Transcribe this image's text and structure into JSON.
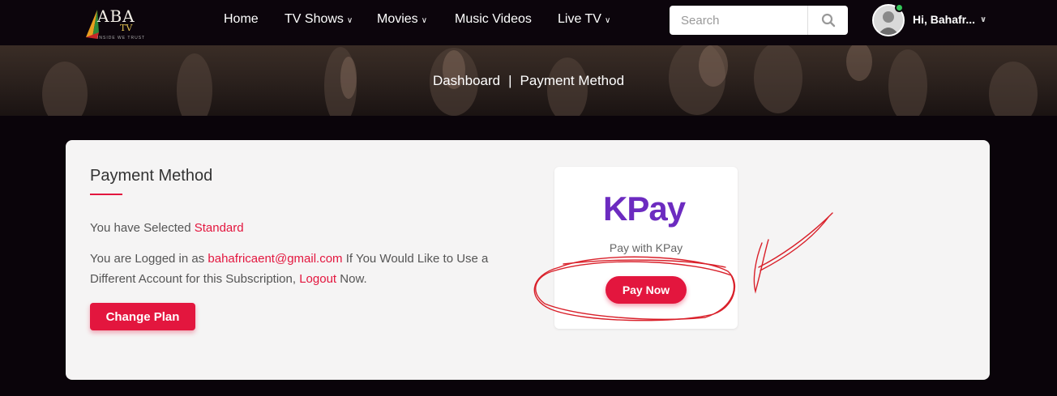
{
  "header": {
    "logo": {
      "letters": "ABA",
      "sub": "TV",
      "tagline": "INSIDE WE TRUST"
    },
    "nav": [
      {
        "label": "Home",
        "has_dropdown": false
      },
      {
        "label": "TV Shows",
        "has_dropdown": true
      },
      {
        "label": "Movies",
        "has_dropdown": true
      },
      {
        "label": "Music Videos",
        "has_dropdown": false
      },
      {
        "label": "Live TV",
        "has_dropdown": true
      }
    ],
    "search": {
      "placeholder": "Search",
      "icon": "search-icon"
    },
    "user": {
      "greeting": "Hi, Bahafr...",
      "status": "online"
    }
  },
  "breadcrumb": {
    "home": "Dashboard",
    "separator": "|",
    "current": "Payment Method"
  },
  "payment": {
    "title": "Payment Method",
    "selected_prefix": "You have Selected",
    "selected_plan": "Standard",
    "logged_prefix": "You are Logged in as",
    "email": "bahafricaent@gmail.com",
    "logged_middle": "If You Would Like to Use a Different Account for this Subscription,",
    "logout": "Logout",
    "logged_suffix": "Now.",
    "change_plan": "Change Plan"
  },
  "kpay": {
    "logo": "KPay",
    "caption": "Pay with KPay",
    "button": "Pay Now"
  },
  "colors": {
    "accent": "#e3163e",
    "kpay": "#6c2bc0",
    "dark_bg": "#0a040a"
  }
}
